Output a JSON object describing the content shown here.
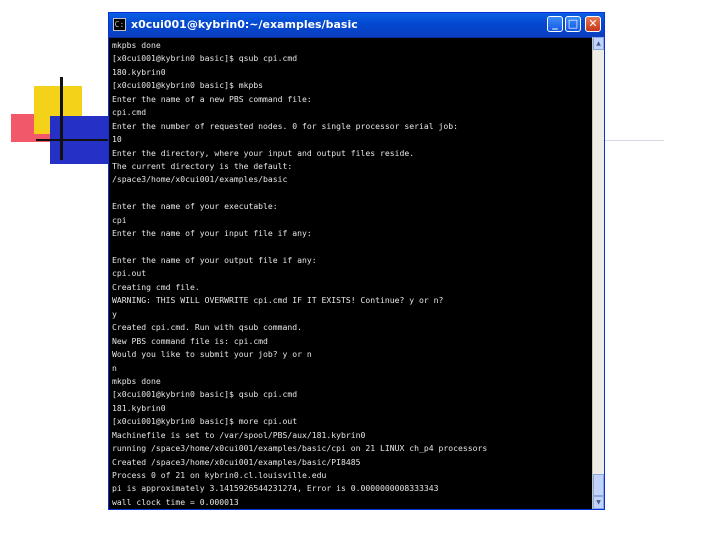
{
  "window": {
    "title": "x0cui001@kybrin0:~/examples/basic",
    "icon_name": "terminal-icon",
    "minimize_glyph": "_",
    "maximize_glyph": "□",
    "close_glyph": "✕"
  },
  "scrollbar": {
    "up_glyph": "▲",
    "down_glyph": "▼",
    "position": 0.95
  },
  "console": {
    "lines": [
      "mkpbs done",
      "[x0cui001@kybrin0 basic]$ qsub cpi.cmd",
      "180.kybrin0",
      "[x0cui001@kybrin0 basic]$ mkpbs",
      "Enter the name of a new PBS command file:",
      "cpi.cmd",
      "Enter the number of requested nodes. 0 for single processor serial job:",
      "10",
      "Enter the directory, where your input and output files reside.",
      "The current directory is the default:",
      "/space3/home/x0cui001/examples/basic",
      "",
      "Enter the name of your executable:",
      "cpi",
      "Enter the name of your input file if any:",
      "",
      "Enter the name of your output file if any:",
      "cpi.out",
      "Creating cmd file.",
      "WARNING: THIS WILL OVERWRITE cpi.cmd IF IT EXISTS! Continue? y or n?",
      "y",
      "Created cpi.cmd. Run with qsub command.",
      "New PBS command file is: cpi.cmd",
      "Would you like to submit your job? y or n",
      "n",
      "mkpbs done",
      "[x0cui001@kybrin0 basic]$ qsub cpi.cmd",
      "181.kybrin0",
      "[x0cui001@kybrin0 basic]$ more cpi.out",
      "Machinefile is set to /var/spool/PBS/aux/181.kybrin0",
      "running /space3/home/x0cui001/examples/basic/cpi on 21 LINUX ch_p4 processors",
      "Created /space3/home/x0cui001/examples/basic/PI8485",
      "Process 0 of 21 on kybrin0.cl.louisville.edu",
      "pi is approximately 3.1415926544231274, Error is 0.0000000008333343",
      "wall clock time = 0.000013"
    ]
  }
}
